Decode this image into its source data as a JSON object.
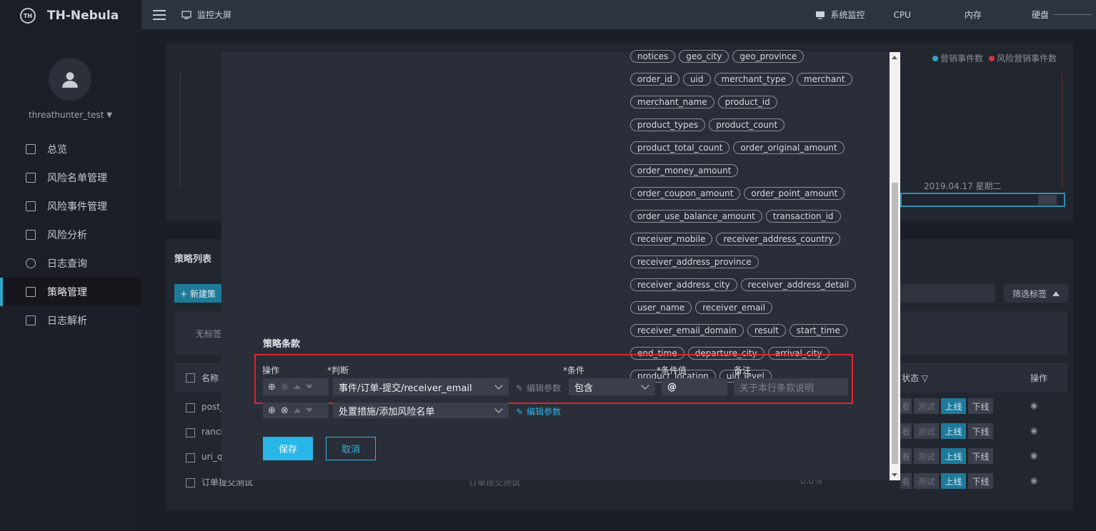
{
  "app": {
    "brand": "TH-Nebula",
    "logo_text": "TH"
  },
  "user": {
    "name": "threathunter_test"
  },
  "sidebar": {
    "items": [
      {
        "label": "总览",
        "icon": "grid-icon"
      },
      {
        "label": "风险名单管理",
        "icon": "list-icon"
      },
      {
        "label": "风险事件管理",
        "icon": "event-icon"
      },
      {
        "label": "风险分析",
        "icon": "chart-icon"
      },
      {
        "label": "日志查询",
        "icon": "search-icon"
      },
      {
        "label": "策略管理",
        "icon": "strategy-icon"
      },
      {
        "label": "日志解析",
        "icon": "doc-icon"
      }
    ]
  },
  "topbar": {
    "monitor_label": "监控大屏",
    "system_monitor": "系统监控",
    "cpu": "CPU",
    "memory": "内存",
    "disk": "硬盘"
  },
  "background": {
    "legend_a": "营销事件数",
    "legend_b": "风险营销事件数",
    "chart_date": "2019.04.17 星期二",
    "policy_list_title": "策略列表",
    "new_button": "+ 新建策",
    "filter_tags": "筛选标签",
    "no_tag": "无标签",
    "col_name": "名称",
    "col_status": "状态",
    "col_ops": "操作",
    "rows": [
      {
        "name": "post_"
      },
      {
        "name": "ranch"
      },
      {
        "name": "uri_q"
      },
      {
        "name": "订单提交测试",
        "desc": "订单提交测试",
        "pct": "0.0%"
      }
    ],
    "row_btn_view": "看",
    "row_btn_test": "测试",
    "row_btn_online": "上线",
    "row_btn_offline": "下线"
  },
  "modal": {
    "tags": [
      "notices",
      "geo_city",
      "geo_province",
      "order_id",
      "uid",
      "merchant_type",
      "merchant",
      "merchant_name",
      "product_id",
      "product_types",
      "product_count",
      "product_total_count",
      "order_original_amount",
      "order_money_amount",
      "order_coupon_amount",
      "order_point_amount",
      "order_use_balance_amount",
      "transaction_id",
      "receiver_mobile",
      "receiver_address_country",
      "receiver_address_province",
      "receiver_address_city",
      "receiver_address_detail",
      "user_name",
      "receiver_email",
      "receiver_email_domain",
      "result",
      "start_time",
      "end_time",
      "departure_city",
      "arrival_city",
      "product_location",
      "uid_level"
    ],
    "section_title": "策略条款",
    "headers": {
      "op": "操作",
      "judge": "*判断",
      "cond": "*条件",
      "cond_value": "*条件值",
      "remark": "备注"
    },
    "row1": {
      "judge": "事件/订单-提交/receiver_email",
      "edit": "编辑参数",
      "cond": "包含",
      "value": "@",
      "remark_placeholder": "关于本行条款说明"
    },
    "row2": {
      "judge": "处置措施/添加风险名单",
      "edit": "编辑参数"
    },
    "save": "保存",
    "cancel": "取消"
  }
}
